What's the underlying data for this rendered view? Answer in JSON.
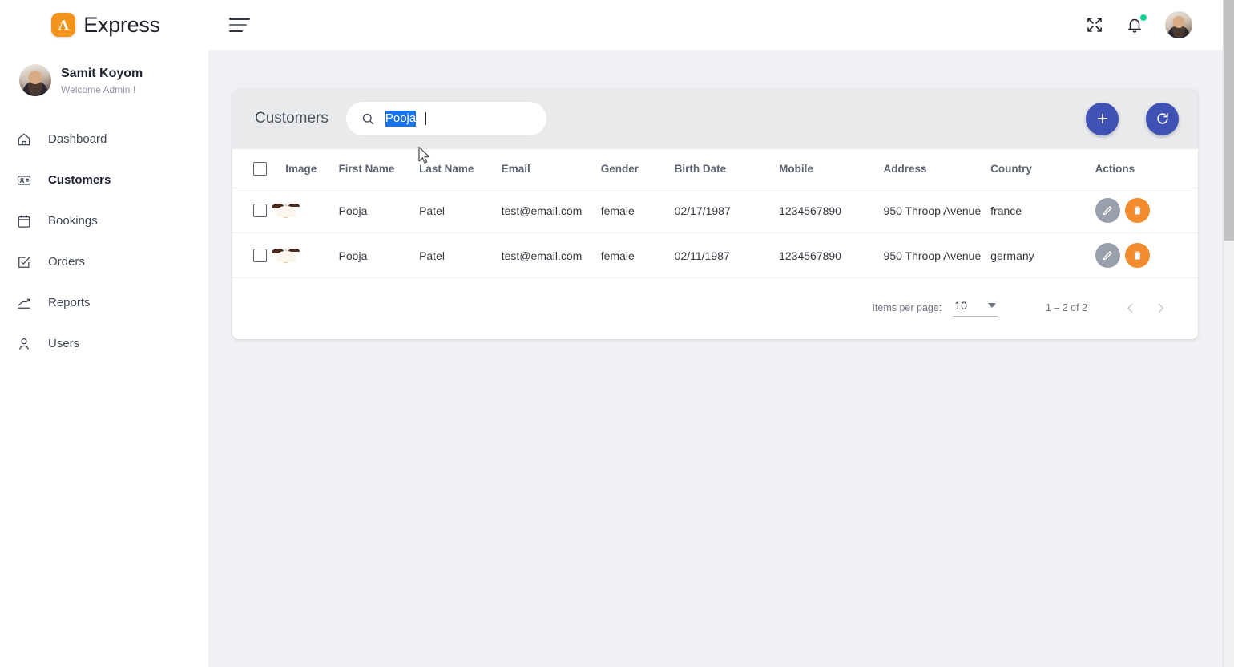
{
  "brand": {
    "mark_letter": "A",
    "name": "Express"
  },
  "profile": {
    "name": "Samit Koyom",
    "subtitle": "Welcome Admin !",
    "avatar_icon": "user-avatar"
  },
  "sidebar": {
    "items": [
      {
        "label": "Dashboard",
        "icon": "home-icon",
        "active": false
      },
      {
        "label": "Customers",
        "icon": "contact-card-icon",
        "active": true
      },
      {
        "label": "Bookings",
        "icon": "calendar-icon",
        "active": false
      },
      {
        "label": "Orders",
        "icon": "checklist-icon",
        "active": false
      },
      {
        "label": "Reports",
        "icon": "trend-up-icon",
        "active": false
      },
      {
        "label": "Users",
        "icon": "person-icon",
        "active": false
      }
    ]
  },
  "topbar": {
    "menu_icon": "hamburger-icon",
    "fullscreen_icon": "expand-arrows-icon",
    "notifications_icon": "bell-icon",
    "notification_dot_color": "#0ed397",
    "avatar_icon": "user-avatar"
  },
  "card": {
    "title": "Customers",
    "search": {
      "value": "Pooja",
      "placeholder": "",
      "icon": "search-icon",
      "selected": true
    },
    "add_button": {
      "label": "+",
      "icon": "plus-icon"
    },
    "refresh_button": {
      "label": "",
      "icon": "refresh-icon"
    },
    "button_color": "#3f51b5"
  },
  "table": {
    "columns": [
      "",
      "Image",
      "First Name",
      "Last Name",
      "Email",
      "Gender",
      "Birth Date",
      "Mobile",
      "Address",
      "Country",
      "Actions"
    ],
    "rows": [
      {
        "checked": false,
        "image": "customer-photo",
        "first_name": "Pooja",
        "last_name": "Patel",
        "email": "test@email.com",
        "gender": "female",
        "birth_date": "02/17/1987",
        "mobile": "1234567890",
        "address": "950 Throop Avenue",
        "country": "france"
      },
      {
        "checked": false,
        "image": "customer-photo",
        "first_name": "Pooja",
        "last_name": "Patel",
        "email": "test@email.com",
        "gender": "female",
        "birth_date": "02/11/1987",
        "mobile": "1234567890",
        "address": "950 Throop Avenue",
        "country": "germany"
      }
    ],
    "actions": {
      "edit_icon": "pencil-icon",
      "delete_icon": "trash-icon",
      "edit_color": "#9aa0ab",
      "delete_color": "#f28a2e"
    }
  },
  "paginator": {
    "items_per_page_label": "Items per page:",
    "items_per_page_value": "10",
    "range_label": "1 – 2 of 2",
    "prev_icon": "chevron-left-icon",
    "next_icon": "chevron-right-icon"
  }
}
